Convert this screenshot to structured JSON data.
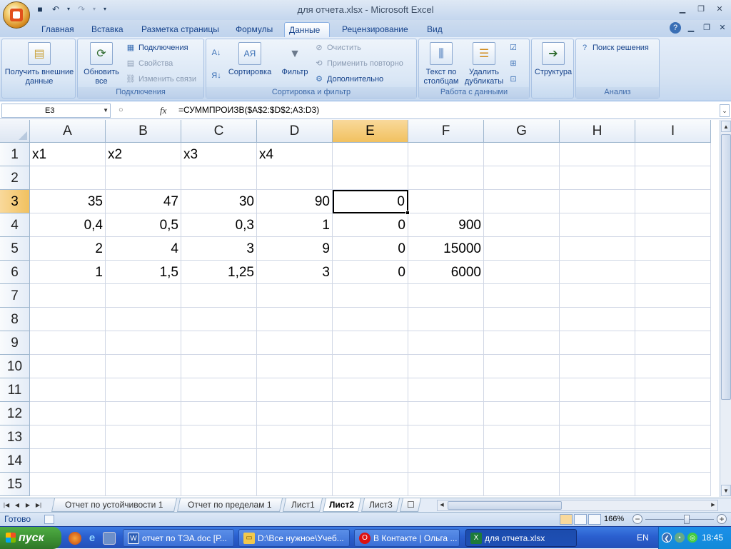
{
  "window": {
    "title": "для отчета.xlsx - Microsoft Excel"
  },
  "ribbon_tabs": [
    "Главная",
    "Вставка",
    "Разметка страницы",
    "Формулы",
    "Данные",
    "Рецензирование",
    "Вид"
  ],
  "ribbon": {
    "get_external_data": "Получить внешние данные",
    "refresh_all": "Обновить все",
    "connections": "Подключения",
    "properties": "Свойства",
    "edit_links": "Изменить связи",
    "group_connections": "Подключения",
    "sort": "Сортировка",
    "filter": "Фильтр",
    "clear": "Очистить",
    "reapply": "Применить повторно",
    "advanced": "Дополнительно",
    "group_sort_filter": "Сортировка и фильтр",
    "text_to_columns": "Текст по столбцам",
    "remove_duplicates": "Удалить дубликаты",
    "group_data_tools": "Работа с данными",
    "outline": "Структура",
    "solver": "Поиск решения",
    "group_analysis": "Анализ"
  },
  "formula_bar": {
    "name_box": "E3",
    "formula": "=СУММПРОИЗВ($A$2:$D$2;A3:D3)"
  },
  "columns": [
    "A",
    "B",
    "C",
    "D",
    "E",
    "F",
    "G",
    "H",
    "I"
  ],
  "rows": [
    "1",
    "2",
    "3",
    "4",
    "5",
    "6",
    "7",
    "8",
    "9",
    "10",
    "11",
    "12",
    "13",
    "14",
    "15"
  ],
  "cells": {
    "A1": "x1",
    "B1": "x2",
    "C1": "x3",
    "D1": "x4",
    "A3": "35",
    "B3": "47",
    "C3": "30",
    "D3": "90",
    "E3": "0",
    "A4": "0,4",
    "B4": "0,5",
    "C4": "0,3",
    "D4": "1",
    "E4": "0",
    "F4": "900",
    "A5": "2",
    "B5": "4",
    "C5": "3",
    "D5": "9",
    "E5": "0",
    "F5": "15000",
    "A6": "1",
    "B6": "1,5",
    "C6": "1,25",
    "D6": "3",
    "E6": "0",
    "F6": "6000"
  },
  "sheet_tabs": [
    "Отчет по устойчивости 1",
    "Отчет по пределам 1",
    "Лист1",
    "Лист2",
    "Лист3"
  ],
  "active_sheet": "Лист2",
  "status": {
    "ready": "Готово",
    "zoom": "166%"
  },
  "taskbar": {
    "start": "пуск",
    "tasks": [
      "отчет по ТЭА.doc [Р...",
      "D:\\Все нужное\\Учеб...",
      "В Контакте | Ольга ...",
      "для отчета.xlsx"
    ],
    "lang": "EN",
    "clock": "18:45"
  },
  "colors": {
    "selection_header": "#f1c15f",
    "ribbon_text": "#15428b",
    "taskbar": "#2a5fcf"
  }
}
